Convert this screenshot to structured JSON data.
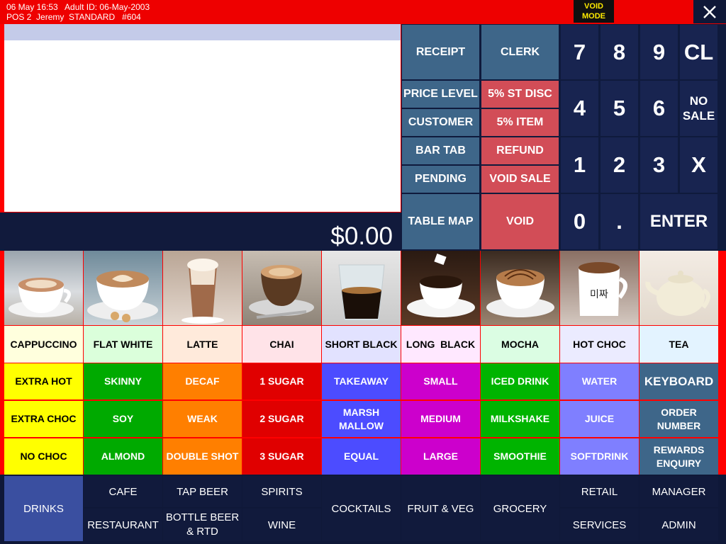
{
  "header": {
    "line1": "06 May 16:53   Adult ID: 06-May-2003",
    "line2": "POS 2  Jeremy  STANDARD   #604",
    "mode_badge": "VOID\nMODE"
  },
  "receipt": {
    "total": "$0.00"
  },
  "function_buttons": {
    "receipt": "RECEIPT",
    "clerk": "CLERK",
    "price_level": "PRICE LEVEL",
    "st_disc": "5% ST DISC",
    "customer": "CUSTOMER",
    "item_disc": "5% ITEM",
    "bar_tab": "BAR TAB",
    "refund": "REFUND",
    "pending": "PENDING",
    "void_sale": "VOID SALE",
    "table_map": "TABLE MAP",
    "void": "VOID"
  },
  "numpad": {
    "k7": "7",
    "k8": "8",
    "k9": "9",
    "cl": "CL",
    "k4": "4",
    "k5": "5",
    "k6": "6",
    "no_sale": "NO\nSALE",
    "k1": "1",
    "k2": "2",
    "k3": "3",
    "x": "X",
    "k0": "0",
    "dot": ".",
    "enter": "ENTER"
  },
  "products": [
    {
      "label": "CAPPUCCINO",
      "bg": "#ffffdd"
    },
    {
      "label": "FLAT WHITE",
      "bg": "#dbffdb"
    },
    {
      "label": "LATTE",
      "bg": "#ffeadb"
    },
    {
      "label": "CHAI",
      "bg": "#ffe3e8"
    },
    {
      "label": "SHORT BLACK",
      "bg": "#e2e2ff"
    },
    {
      "label": "LONG  BLACK",
      "bg": "#ffe8ff"
    },
    {
      "label": "MOCHA",
      "bg": "#dbfde3"
    },
    {
      "label": "HOT CHOC",
      "bg": "#ebebff"
    },
    {
      "label": "TEA",
      "bg": "#e3f3ff"
    }
  ],
  "modifiers": [
    [
      "EXTRA HOT",
      "SKINNY",
      "DECAF",
      "1 SUGAR",
      "TAKEAWAY",
      "SMALL",
      "ICED DRINK",
      "WATER",
      "KEYBOARD"
    ],
    [
      "EXTRA CHOC",
      "SOY",
      "WEAK",
      "2 SUGAR",
      "MARSH\nMALLOW",
      "MEDIUM",
      "MILKSHAKE",
      "JUICE",
      "ORDER\nNUMBER"
    ],
    [
      "NO CHOC",
      "ALMOND",
      "DOUBLE SHOT",
      "3 SUGAR",
      "EQUAL",
      "LARGE",
      "SMOOTHIE",
      "SOFTDRINK",
      "REWARDS\nENQUIRY"
    ]
  ],
  "modifier_colors": {
    "column_bg": [
      "#ffff00",
      "#00aa00",
      "#ff7f00",
      "#e00000",
      "#4c4cff",
      "#cc00cc",
      "#00b400",
      "#7f7fff",
      "#3e6689"
    ],
    "column_text": [
      "#000000",
      "#ffffff",
      "#ffffff",
      "#ffffff",
      "#ffffff",
      "#ffffff",
      "#ffffff",
      "#ffffff",
      "#ffffff"
    ]
  },
  "categories": {
    "drinks": "DRINKS",
    "cafe": "CAFE",
    "restaurant": "RESTAURANT",
    "tap_beer": "TAP BEER",
    "bottle_beer": "BOTTLE BEER\n& RTD",
    "spirits": "SPIRITS",
    "wine": "WINE",
    "cocktails": "COCKTAILS",
    "fruit_veg": "FRUIT & VEG",
    "grocery": "GROCERY",
    "retail": "RETAIL",
    "services": "SERVICES",
    "manager": "MANAGER",
    "admin": "ADMIN"
  },
  "colors": {
    "frame": "#ff0000",
    "navy": "#0f1a3c",
    "steel_blue": "#3e6689",
    "red_button": "#d24d57",
    "selected_category": "#3a4fa0"
  }
}
